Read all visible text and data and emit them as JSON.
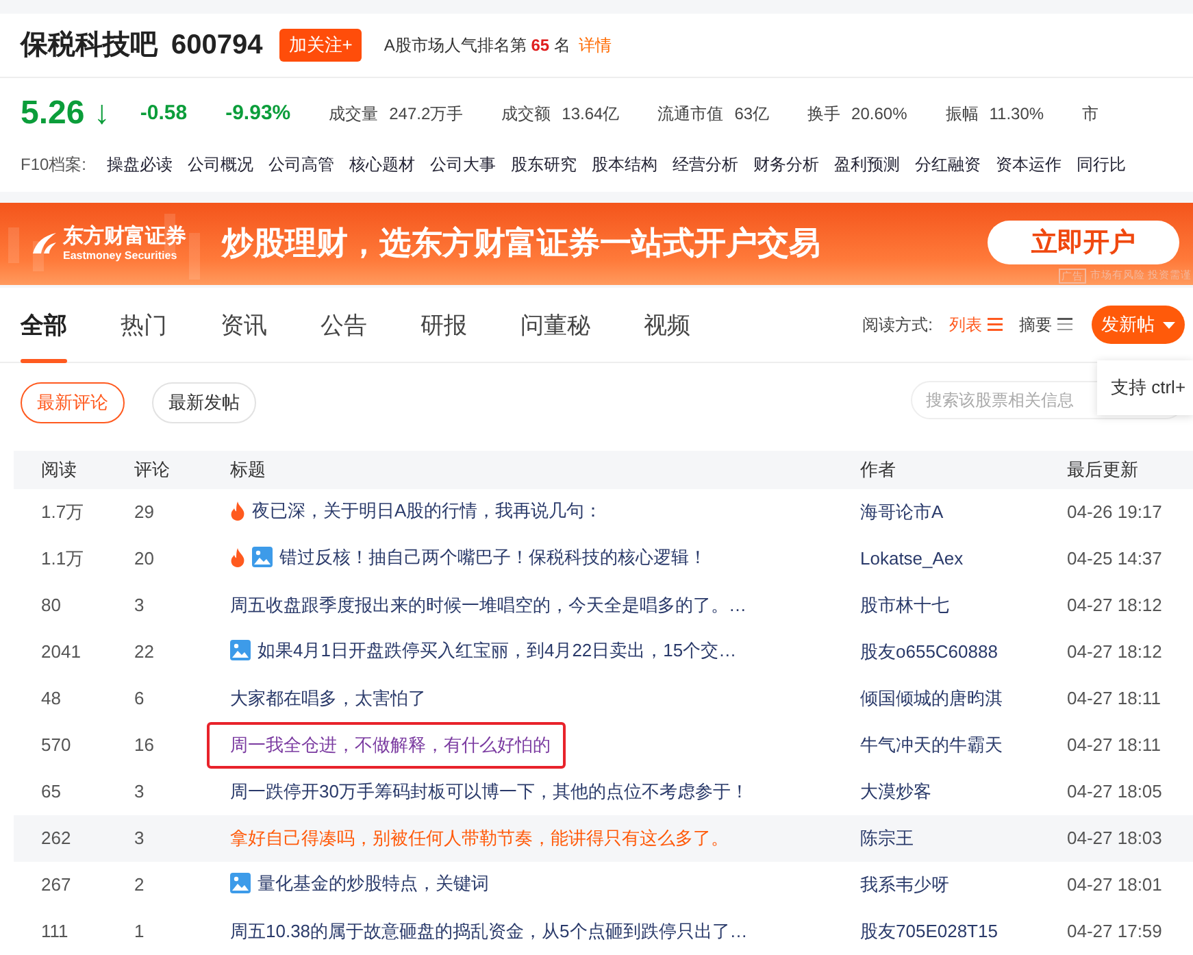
{
  "header": {
    "title": "保税科技吧",
    "code": "600794",
    "follow_button": "加关注+",
    "rank_prefix": "A股市场人气排名第",
    "rank": "65",
    "rank_suffix": "名",
    "detail_link": "详情"
  },
  "quote": {
    "price": "5.26",
    "arrow": "↓",
    "change": "-0.58",
    "change_pct": "-9.93%",
    "stats": [
      {
        "label": "成交量",
        "value": "247.2万手"
      },
      {
        "label": "成交额",
        "value": "13.64亿"
      },
      {
        "label": "流通市值",
        "value": "63亿"
      },
      {
        "label": "换手",
        "value": "20.60%"
      },
      {
        "label": "振幅",
        "value": "11.30%"
      },
      {
        "label": "市"
      }
    ]
  },
  "f10": {
    "label": "F10档案:",
    "links": [
      "操盘必读",
      "公司概况",
      "公司高管",
      "核心题材",
      "公司大事",
      "股东研究",
      "股本结构",
      "经营分析",
      "财务分析",
      "盈利预测",
      "分红融资",
      "资本运作",
      "同行比"
    ]
  },
  "banner": {
    "brand": "东方财富证券",
    "brand_en": "Eastmoney Securities",
    "slogan": "炒股理财，选东方财富证券一站式开户交易",
    "button": "立即开户",
    "ad_tag": "广告",
    "disclaimer": "市场有风险 投资需谨"
  },
  "tabs": [
    {
      "label": "全部",
      "selected": true
    },
    {
      "label": "热门",
      "selected": false
    },
    {
      "label": "资讯",
      "selected": false
    },
    {
      "label": "公告",
      "selected": false
    },
    {
      "label": "研报",
      "selected": false
    },
    {
      "label": "问董秘",
      "selected": false
    },
    {
      "label": "视频",
      "selected": false
    }
  ],
  "reading_mode": {
    "label": "阅读方式:",
    "options": [
      {
        "label": "列表",
        "selected": true
      },
      {
        "label": "摘要",
        "selected": false
      }
    ]
  },
  "post_button": "发新帖",
  "tooltip": "支持 ctrl+",
  "sort_buttons": [
    {
      "label": "最新评论",
      "selected": true
    },
    {
      "label": "最新发帖",
      "selected": false
    }
  ],
  "search": {
    "placeholder": "搜索该股票相关信息"
  },
  "table": {
    "columns": [
      "阅读",
      "评论",
      "标题",
      "作者",
      "最后更新"
    ],
    "rows": [
      {
        "reads": "1.7万",
        "comments": "29",
        "hot": true,
        "image": false,
        "title": "夜已深，关于明日A股的行情，我再说几句：",
        "author": "海哥论市A",
        "updated": "04-26 19:17",
        "selected": false,
        "visited": false,
        "boxed": false
      },
      {
        "reads": "1.1万",
        "comments": "20",
        "hot": true,
        "image": true,
        "title": "错过反核！抽自己两个嘴巴子！保税科技的核心逻辑！",
        "author": "Lokatse_Aex",
        "updated": "04-25 14:37",
        "selected": false,
        "visited": false,
        "boxed": false
      },
      {
        "reads": "80",
        "comments": "3",
        "hot": false,
        "image": false,
        "title": "周五收盘跟季度报出来的时候一堆唱空的，今天全是唱多的了。…",
        "author": "股市林十七",
        "updated": "04-27 18:12",
        "selected": false,
        "visited": false,
        "boxed": false
      },
      {
        "reads": "2041",
        "comments": "22",
        "hot": false,
        "image": true,
        "title": "如果4月1日开盘跌停买入红宝丽，到4月22日卖出，15个交…",
        "author": "股友o655C60888",
        "updated": "04-27 18:12",
        "selected": false,
        "visited": false,
        "boxed": false
      },
      {
        "reads": "48",
        "comments": "6",
        "hot": false,
        "image": false,
        "title": "大家都在唱多，太害怕了",
        "author": "倾国倾城的唐昀淇",
        "updated": "04-27 18:11",
        "selected": false,
        "visited": false,
        "boxed": false
      },
      {
        "reads": "570",
        "comments": "16",
        "hot": false,
        "image": false,
        "title": "周一我全仓进，不做解释，有什么好怕的",
        "author": "牛气冲天的牛霸天",
        "updated": "04-27 18:11",
        "selected": false,
        "visited": true,
        "boxed": true
      },
      {
        "reads": "65",
        "comments": "3",
        "hot": false,
        "image": false,
        "title": "周一跌停开30万手筹码封板可以博一下，其他的点位不考虑参于！",
        "author": "大漠炒客",
        "updated": "04-27 18:05",
        "selected": false,
        "visited": false,
        "boxed": false
      },
      {
        "reads": "262",
        "comments": "3",
        "hot": false,
        "image": false,
        "title": "拿好自己得凑吗，别被任何人带勒节奏，能讲得只有这么多了。",
        "author": "陈宗王",
        "updated": "04-27 18:03",
        "selected": true,
        "visited": false,
        "boxed": false
      },
      {
        "reads": "267",
        "comments": "2",
        "hot": false,
        "image": true,
        "title": "量化基金的炒股特点，关键词",
        "author": "我系韦少呀",
        "updated": "04-27 18:01",
        "selected": false,
        "visited": false,
        "boxed": false
      },
      {
        "reads": "111",
        "comments": "1",
        "hot": false,
        "image": false,
        "title": "周五10.38的属于故意砸盘的捣乱资金，从5个点砸到跌停只出了…",
        "author": "股友705E028T15",
        "updated": "04-27 17:59",
        "selected": false,
        "visited": false,
        "boxed": false
      }
    ]
  }
}
